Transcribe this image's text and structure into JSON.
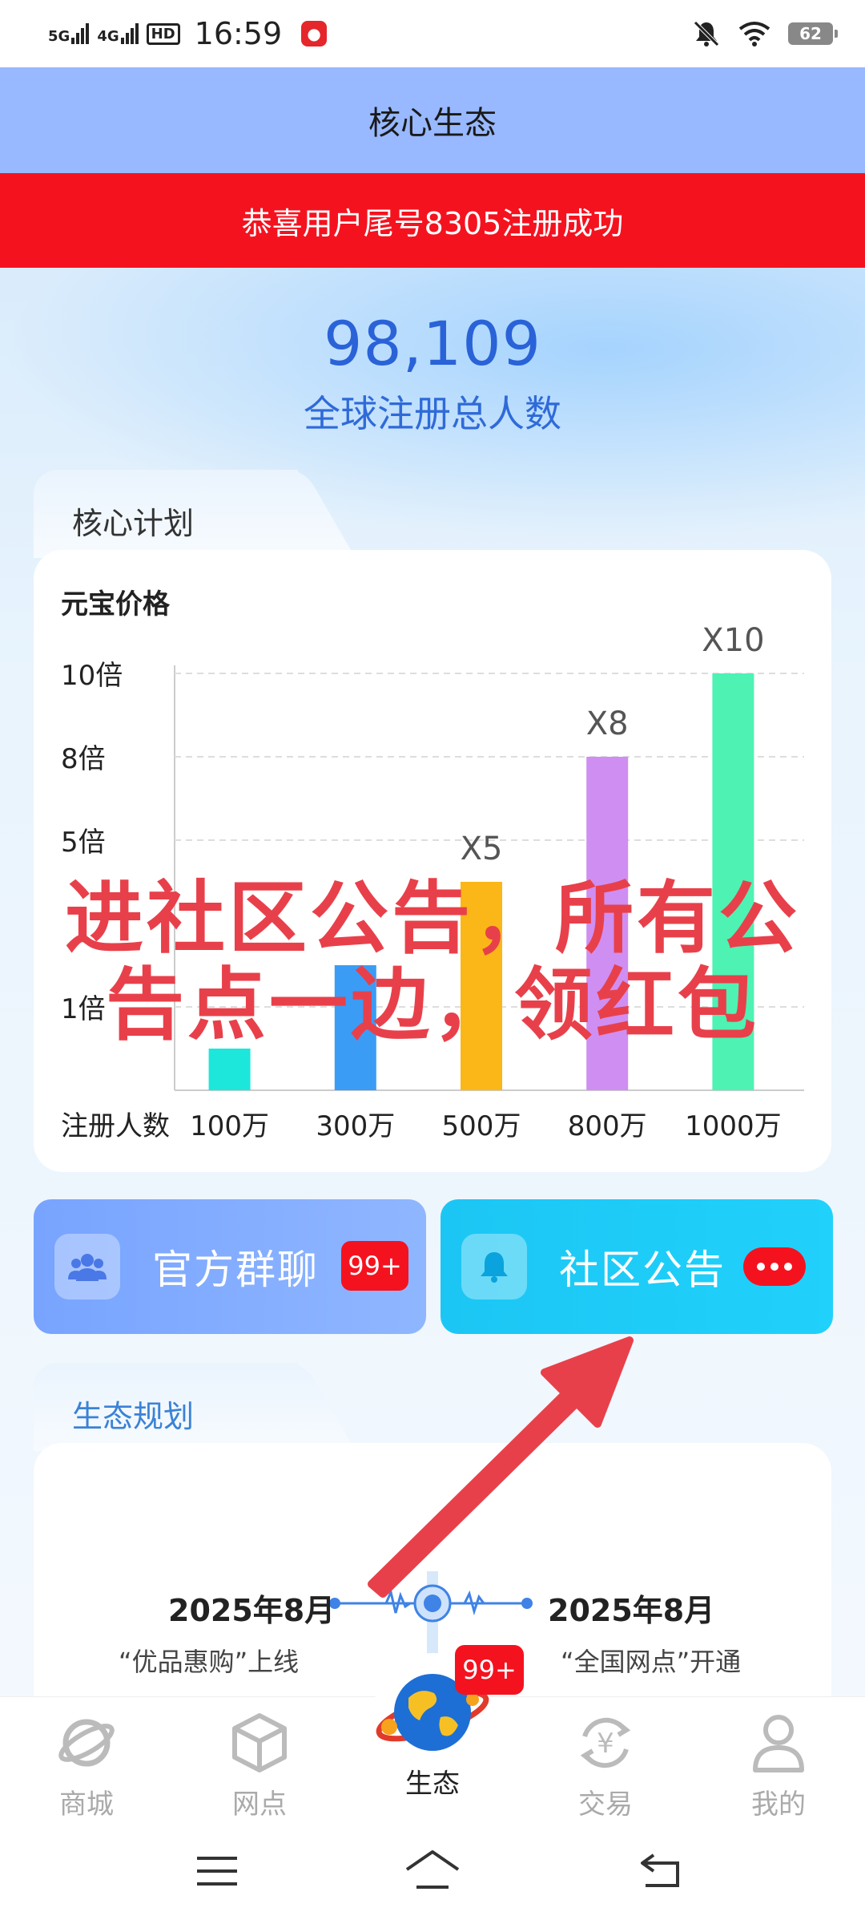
{
  "status_bar": {
    "network1": "5G",
    "network2": "4G",
    "hd": "HD",
    "time": "16:59",
    "battery": "62"
  },
  "header": {
    "title": "核心生态"
  },
  "notice_banner": {
    "text": "恭喜用户尾号8305注册成功"
  },
  "stats": {
    "total_users": "98,109",
    "total_users_label": "全球注册总人数"
  },
  "core_plan": {
    "tab_label": "核心计划",
    "chart_data": {
      "type": "bar",
      "title": "元宝价格",
      "xlabel": "注册人数",
      "categories": [
        "100万",
        "300万",
        "500万",
        "800万",
        "1000万"
      ],
      "values": [
        1,
        3,
        5,
        8,
        10
      ],
      "data_labels": [
        "",
        "",
        "X5",
        "X8",
        "X10"
      ],
      "y_tick_labels": [
        "10倍",
        "8倍",
        "5倍",
        "1倍"
      ],
      "y_tick_values": [
        10,
        8,
        6,
        2
      ],
      "colors": [
        "#1de7da",
        "#3b9cf5",
        "#fbb718",
        "#cf8ef2",
        "#4ef2b3"
      ],
      "ylim": [
        0,
        10
      ],
      "grid": true
    }
  },
  "overlay": {
    "line1": "进社区公告，所有公",
    "line2": "告点一边，领红包"
  },
  "buttons": {
    "group_chat": {
      "label": "官方群聊",
      "badge": "99+",
      "icon": "group-icon"
    },
    "community_notice": {
      "label": "社区公告",
      "icon": "bell-icon"
    }
  },
  "eco_plan": {
    "tab_label": "生态规划",
    "left": {
      "date": "2025年8月",
      "desc": "“优品惠购”上线"
    },
    "right": {
      "date": "2025年8月",
      "desc": "“全国网点”开通"
    }
  },
  "bottom_nav": {
    "items": [
      {
        "label": "商城",
        "icon": "planet-icon"
      },
      {
        "label": "网点",
        "icon": "cube-icon"
      },
      {
        "label": "生态",
        "icon": "globe-icon"
      },
      {
        "label": "交易",
        "icon": "yuan-exchange-icon"
      },
      {
        "label": "我的",
        "icon": "user-icon"
      }
    ],
    "badge": "99+"
  },
  "accent_colors": {
    "header": "#98b8ff",
    "notice": "#f5121f",
    "stat": "#2a62d8",
    "overlay": "#e8404a"
  }
}
